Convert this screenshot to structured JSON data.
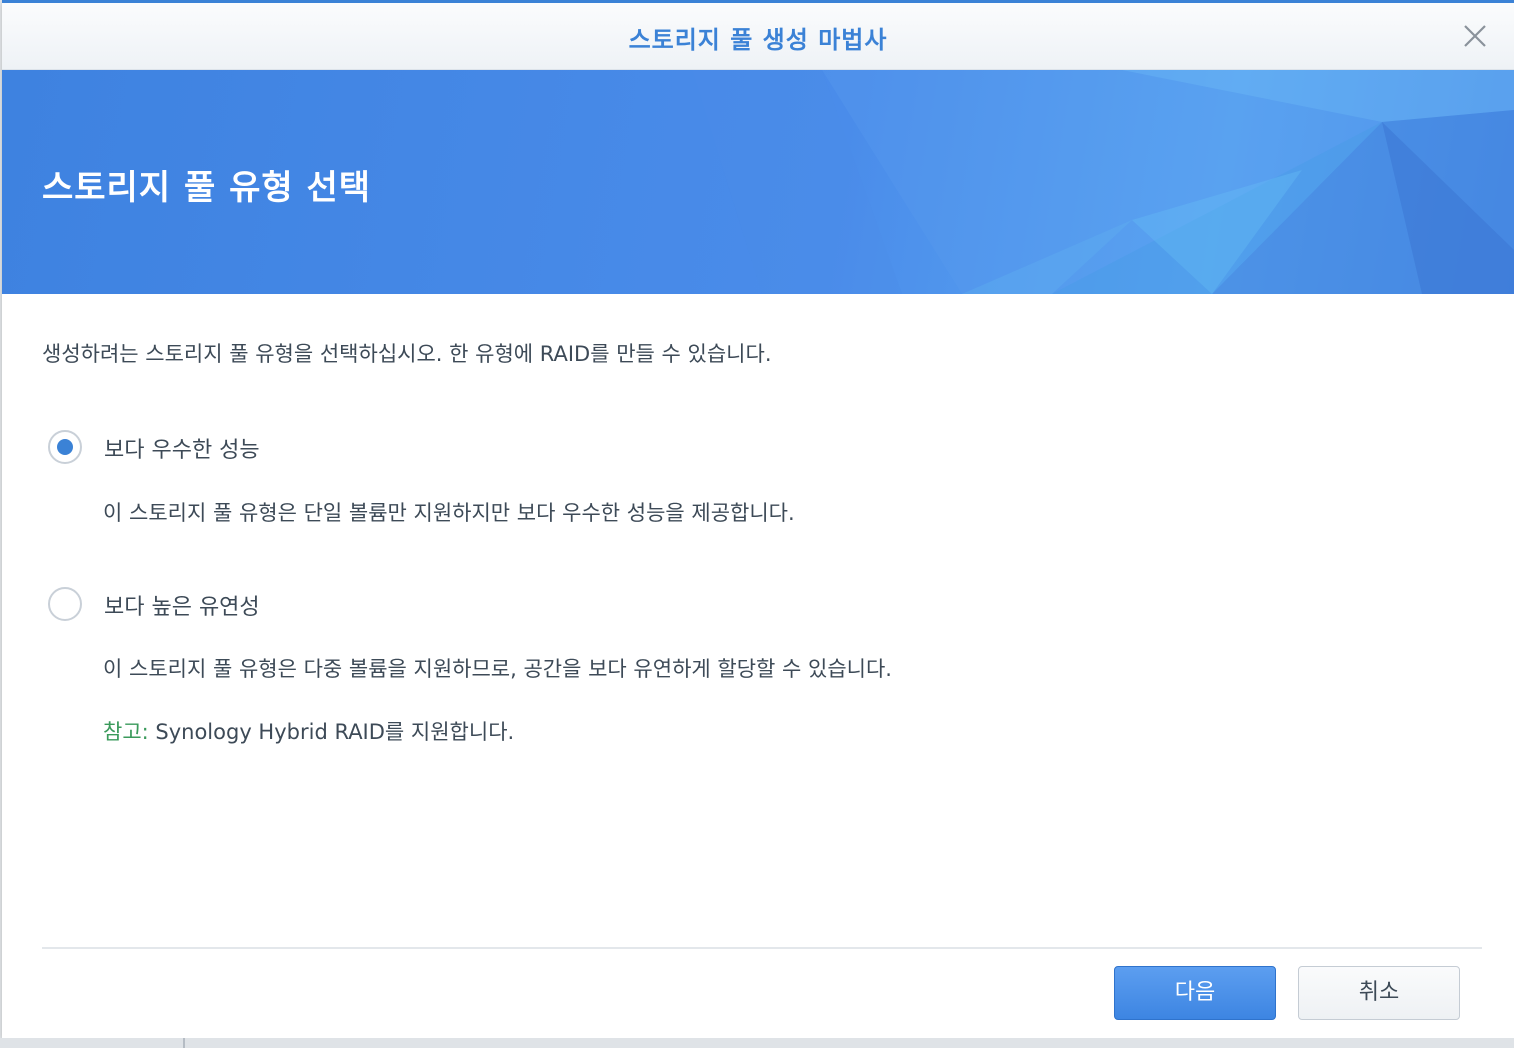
{
  "window": {
    "title": "스토리지 풀 생성 마법사",
    "close_icon": "close-icon"
  },
  "banner": {
    "title": "스토리지 풀 유형 선택"
  },
  "content": {
    "intro": "생성하려는 스토리지 풀 유형을 선택하십시오. 한 유형에 RAID를 만들 수 있습니다.",
    "options": [
      {
        "label": "보다 우수한 성능",
        "selected": true,
        "description": "이 스토리지 풀 유형은 단일 볼륨만 지원하지만 보다 우수한 성능을 제공합니다."
      },
      {
        "label": "보다 높은 유연성",
        "selected": false,
        "description": "이 스토리지 풀 유형은 다중 볼륨을 지원하므로, 공간을 보다 유연하게 할당할 수 있습니다.",
        "note_key": "참고:",
        "note_text": " Synology Hybrid RAID를 지원합니다."
      }
    ]
  },
  "footer": {
    "next_label": "다음",
    "cancel_label": "취소"
  },
  "colors": {
    "accent": "#3b82d6",
    "note": "#3a9a5b",
    "text": "#3d4a57"
  }
}
